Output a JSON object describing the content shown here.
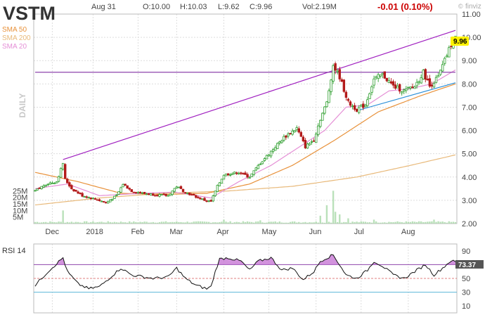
{
  "header": {
    "ticker": "VSTM",
    "date": "Aug 31",
    "open": "O:10.00",
    "high": "H:10.03",
    "low": "L:9.62",
    "close": "C:9.96",
    "volume": "Vol:2.19M",
    "change": "-0.01 (0.10%)",
    "brand": "finviz",
    "brand_copyright": "©"
  },
  "colors": {
    "up": "#2e9e2e",
    "down": "#b31b1b",
    "sma50": "#e8913a",
    "sma200": "#e8b97a",
    "sma20": "#e58fd6",
    "trendline": "#a020c0",
    "support": "#2a8fd8",
    "resistance": "#8e44ad",
    "grid": "#dddddd",
    "price_badge": "#fff200",
    "change": "#cc0000"
  },
  "chart_data": [
    {
      "type": "candlestick",
      "title": "VSTM",
      "ylabel": "DAILY",
      "y_tick_labels": [
        "11.00",
        "10.00",
        "9.00",
        "8.00",
        "7.00",
        "6.00",
        "5.00",
        "4.00",
        "3.00",
        "2.00"
      ],
      "x_tick_labels": [
        "Dec",
        "2018",
        "Feb",
        "Mar",
        "Apr",
        "May",
        "Jun",
        "Jul",
        "Aug"
      ],
      "ylim": [
        2.0,
        11.0
      ],
      "grid": true,
      "legend": [
        "SMA 50",
        "SMA 200",
        "SMA 20"
      ],
      "last_price": "9.96",
      "start_date": "2017-11-20",
      "end_date": "2018-08-31",
      "price_keypoints": [
        [
          0,
          3.4
        ],
        [
          5,
          3.7
        ],
        [
          10,
          3.8
        ],
        [
          13,
          4.6
        ],
        [
          14,
          3.9
        ],
        [
          17,
          3.5
        ],
        [
          22,
          3.2
        ],
        [
          28,
          3.05
        ],
        [
          33,
          2.9
        ],
        [
          38,
          3.2
        ],
        [
          41,
          3.7
        ],
        [
          45,
          3.4
        ],
        [
          50,
          3.3
        ],
        [
          55,
          3.25
        ],
        [
          62,
          3.2
        ],
        [
          66,
          3.6
        ],
        [
          70,
          3.35
        ],
        [
          75,
          3.15
        ],
        [
          79,
          3.0
        ],
        [
          82,
          2.95
        ],
        [
          85,
          3.6
        ],
        [
          88,
          4.1
        ],
        [
          95,
          4.2
        ],
        [
          100,
          4.0
        ],
        [
          105,
          4.6
        ],
        [
          110,
          5.1
        ],
        [
          116,
          5.7
        ],
        [
          122,
          6.1
        ],
        [
          126,
          5.3
        ],
        [
          130,
          5.6
        ],
        [
          133,
          6.5
        ],
        [
          136,
          7.2
        ],
        [
          139,
          8.8
        ],
        [
          142,
          8.3
        ],
        [
          146,
          7.2
        ],
        [
          150,
          6.9
        ],
        [
          154,
          7.1
        ],
        [
          158,
          8.2
        ],
        [
          162,
          8.4
        ],
        [
          167,
          7.9
        ],
        [
          172,
          7.7
        ],
        [
          177,
          7.9
        ],
        [
          181,
          8.5
        ],
        [
          184,
          7.9
        ],
        [
          188,
          8.3
        ],
        [
          191,
          9.0
        ],
        [
          194,
          9.7
        ],
        [
          196,
          9.96
        ]
      ],
      "sma20_keypoints": [
        [
          0,
          3.5
        ],
        [
          15,
          3.7
        ],
        [
          30,
          3.2
        ],
        [
          50,
          3.3
        ],
        [
          65,
          3.35
        ],
        [
          82,
          3.1
        ],
        [
          95,
          3.8
        ],
        [
          110,
          4.5
        ],
        [
          125,
          5.4
        ],
        [
          135,
          6.0
        ],
        [
          145,
          7.0
        ],
        [
          155,
          7.1
        ],
        [
          165,
          7.7
        ],
        [
          175,
          7.8
        ],
        [
          185,
          8.0
        ],
        [
          196,
          8.6
        ]
      ],
      "sma50_keypoints": [
        [
          0,
          4.2
        ],
        [
          20,
          3.8
        ],
        [
          40,
          3.3
        ],
        [
          60,
          3.25
        ],
        [
          80,
          3.3
        ],
        [
          100,
          3.7
        ],
        [
          120,
          4.5
        ],
        [
          140,
          5.6
        ],
        [
          160,
          6.8
        ],
        [
          180,
          7.5
        ],
        [
          196,
          8.0
        ]
      ],
      "sma200_keypoints": [
        [
          0,
          2.8
        ],
        [
          30,
          3.1
        ],
        [
          60,
          3.3
        ],
        [
          90,
          3.4
        ],
        [
          120,
          3.6
        ],
        [
          150,
          4.0
        ],
        [
          175,
          4.5
        ],
        [
          196,
          4.95
        ]
      ],
      "trendlines": [
        {
          "name": "rising-resistance",
          "from": [
            13,
            4.75
          ],
          "to": [
            196,
            10.3
          ]
        },
        {
          "name": "horizontal-level",
          "from": [
            0,
            8.5
          ],
          "to": [
            196,
            8.5
          ]
        },
        {
          "name": "rising-support",
          "from": [
            150,
            6.85
          ],
          "to": [
            196,
            8.05
          ]
        }
      ],
      "volume": {
        "y_tick_labels": [
          "25M",
          "20M",
          "15M",
          "10M",
          "5M"
        ],
        "ylim": [
          0,
          30
        ],
        "baseline": 1.2,
        "spikes": [
          [
            13,
            10
          ],
          [
            88,
            3
          ],
          [
            105,
            2.5
          ],
          [
            133,
            6
          ],
          [
            136,
            14
          ],
          [
            139,
            25
          ],
          [
            140,
            9
          ],
          [
            142,
            7
          ],
          [
            146,
            4
          ],
          [
            158,
            3
          ],
          [
            186,
            3
          ]
        ]
      }
    },
    {
      "type": "line",
      "title": "RSI 14",
      "y_tick_labels": [
        "90",
        "70",
        "50",
        "30",
        "10"
      ],
      "ylim": [
        0,
        100
      ],
      "reference_lines": [
        70,
        50,
        30
      ],
      "last_value": "73.37",
      "keypoints": [
        [
          0,
          40
        ],
        [
          6,
          60
        ],
        [
          13,
          80
        ],
        [
          15,
          60
        ],
        [
          20,
          42
        ],
        [
          25,
          35
        ],
        [
          30,
          38
        ],
        [
          40,
          65
        ],
        [
          45,
          55
        ],
        [
          55,
          50
        ],
        [
          62,
          52
        ],
        [
          66,
          65
        ],
        [
          70,
          50
        ],
        [
          75,
          40
        ],
        [
          80,
          35
        ],
        [
          82,
          38
        ],
        [
          84,
          60
        ],
        [
          86,
          78
        ],
        [
          90,
          80
        ],
        [
          96,
          75
        ],
        [
          100,
          62
        ],
        [
          104,
          75
        ],
        [
          110,
          80
        ],
        [
          115,
          62
        ],
        [
          120,
          65
        ],
        [
          125,
          48
        ],
        [
          130,
          60
        ],
        [
          133,
          75
        ],
        [
          136,
          80
        ],
        [
          139,
          84
        ],
        [
          142,
          70
        ],
        [
          145,
          55
        ],
        [
          150,
          50
        ],
        [
          155,
          62
        ],
        [
          158,
          75
        ],
        [
          162,
          68
        ],
        [
          167,
          55
        ],
        [
          172,
          50
        ],
        [
          177,
          60
        ],
        [
          182,
          70
        ],
        [
          186,
          55
        ],
        [
          190,
          65
        ],
        [
          194,
          76
        ],
        [
          196,
          73.37
        ]
      ]
    }
  ]
}
